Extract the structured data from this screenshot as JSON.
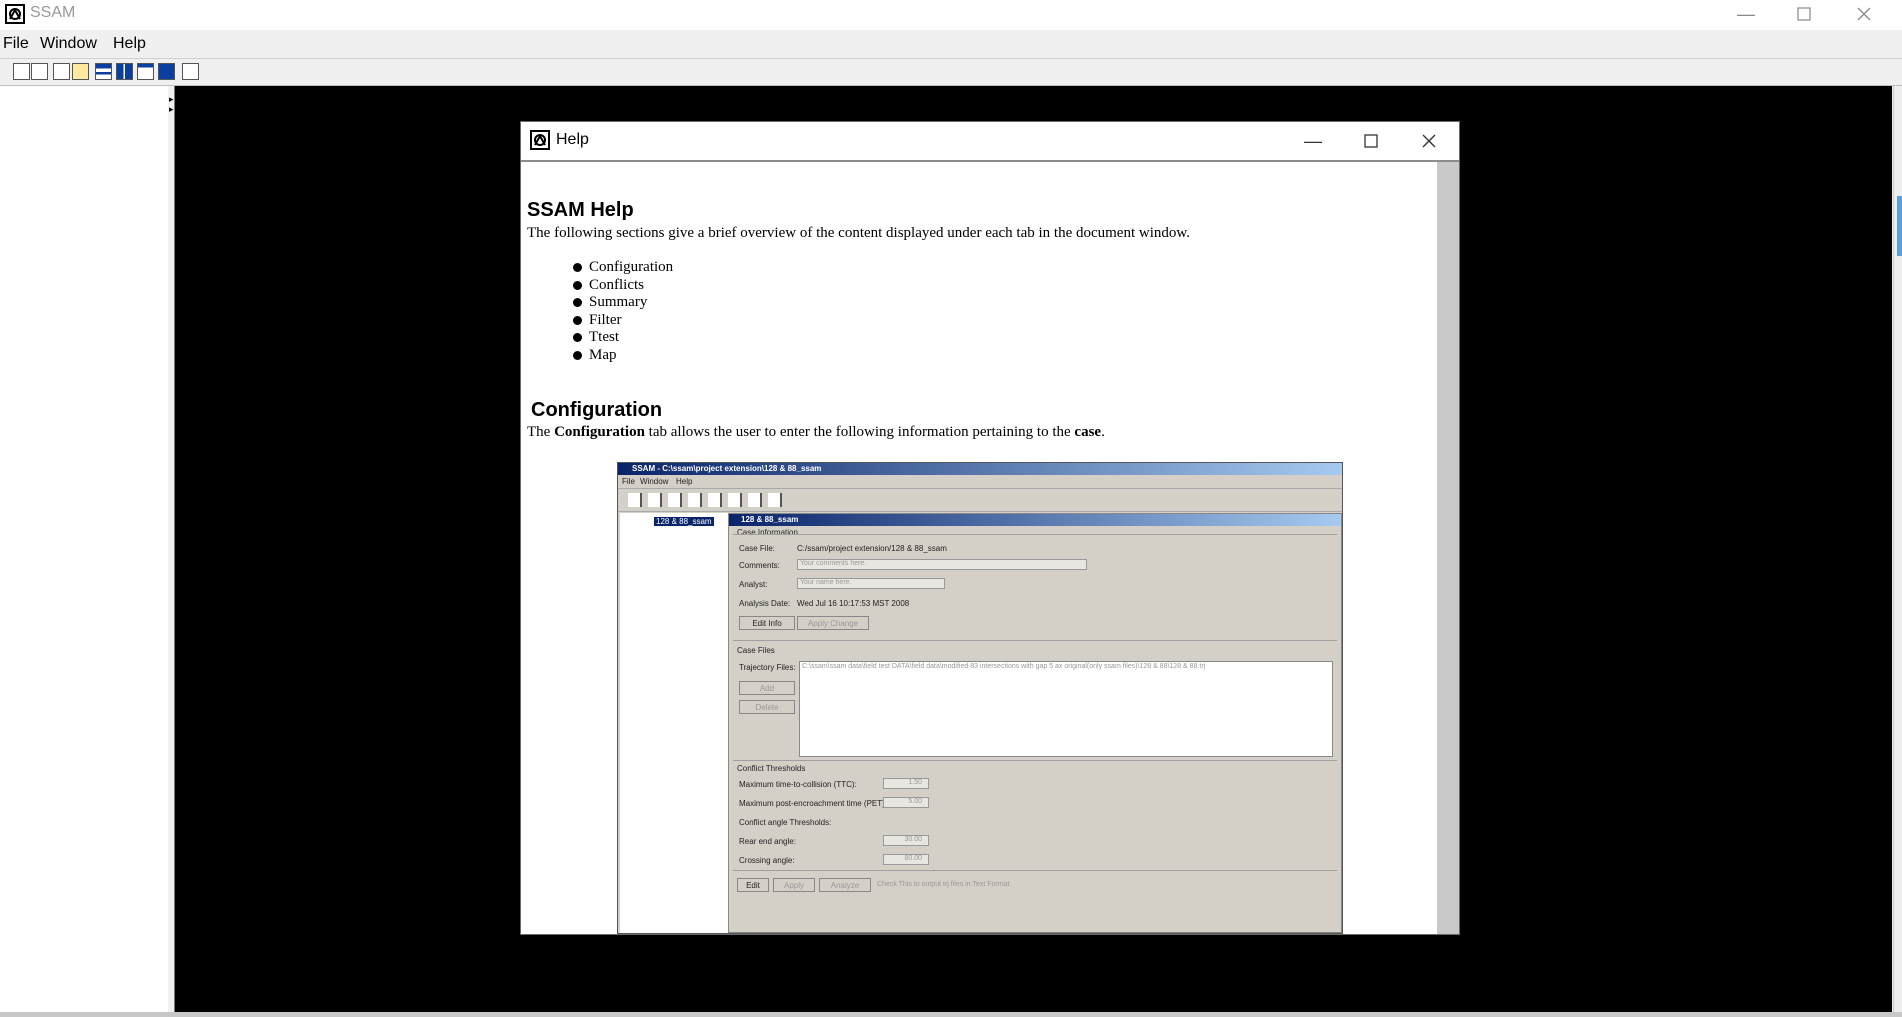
{
  "app": {
    "title": "SSAM",
    "menu": [
      "File",
      "Window",
      "Help"
    ],
    "toolbar_icons": [
      "new-icon",
      "open-icon",
      "save-icon",
      "cascade-icon",
      "tile-horizontal-icon",
      "tile-vertical-icon",
      "tile-grid-icon",
      "arrange-icon",
      "calculator-icon"
    ]
  },
  "help_window": {
    "title": "Help",
    "heading": "SSAM Help",
    "intro": "The following sections give a brief overview of the content displayed under each tab in the document window.",
    "sections": [
      "Configuration",
      "Conflicts",
      "Summary",
      "Filter",
      "Ttest",
      "Map"
    ],
    "config_heading": "Configuration",
    "config_text": {
      "pre": "The ",
      "bold1": "Configuration",
      "mid": " tab allows the user to enter the following information pertaining to the ",
      "bold2": "case",
      "post": "."
    }
  },
  "embedded_screenshot": {
    "title": "SSAM - C:\\ssam\\project extension\\128 & 88_ssam",
    "menu": [
      "File",
      "Window",
      "Help"
    ],
    "tree_item": "128 & 88_ssam",
    "inner_title": "128 & 88_ssam",
    "case_info_label": "Case Information",
    "case_file_label": "Case File:",
    "case_file_value": "C:/ssam/project extension/128 & 88_ssam",
    "comments_label": "Comments:",
    "comments_placeholder": "Your comments here.",
    "analyst_label": "Analyst:",
    "analyst_placeholder": "Your name here.",
    "analysis_date_label": "Analysis Date:",
    "analysis_date_value": "Wed Jul 16 10:17:53 MST 2008",
    "edit_info": "Edit Info",
    "apply_change": "Apply Change",
    "case_files_label": "Case Files",
    "trajectory_label": "Trajectory Files:",
    "trajectory_value": "C:\\ssam\\ssam data\\field test DATA\\field data\\modified 83 intersections with gap 5 ax original(only ssam files)\\128 & 88\\128 & 88.trj",
    "add": "Add",
    "delete": "Delete",
    "thresholds_label": "Conflict Thresholds",
    "ttc_label": "Maximum time-to-collision (TTC):",
    "ttc_value": "1.50",
    "pet_label": "Maximum post-encroachment time (PET):",
    "pet_value": "5.00",
    "angle_label": "Conflict angle Thresholds:",
    "rear_label": "Rear end angle:",
    "rear_value": "30.00",
    "crossing_label": "Crossing angle:",
    "crossing_value": "80.00",
    "edit": "Edit",
    "apply": "Apply",
    "analyze": "Analyze",
    "checkbox_label": "Check This to output trj files in Text Format"
  }
}
